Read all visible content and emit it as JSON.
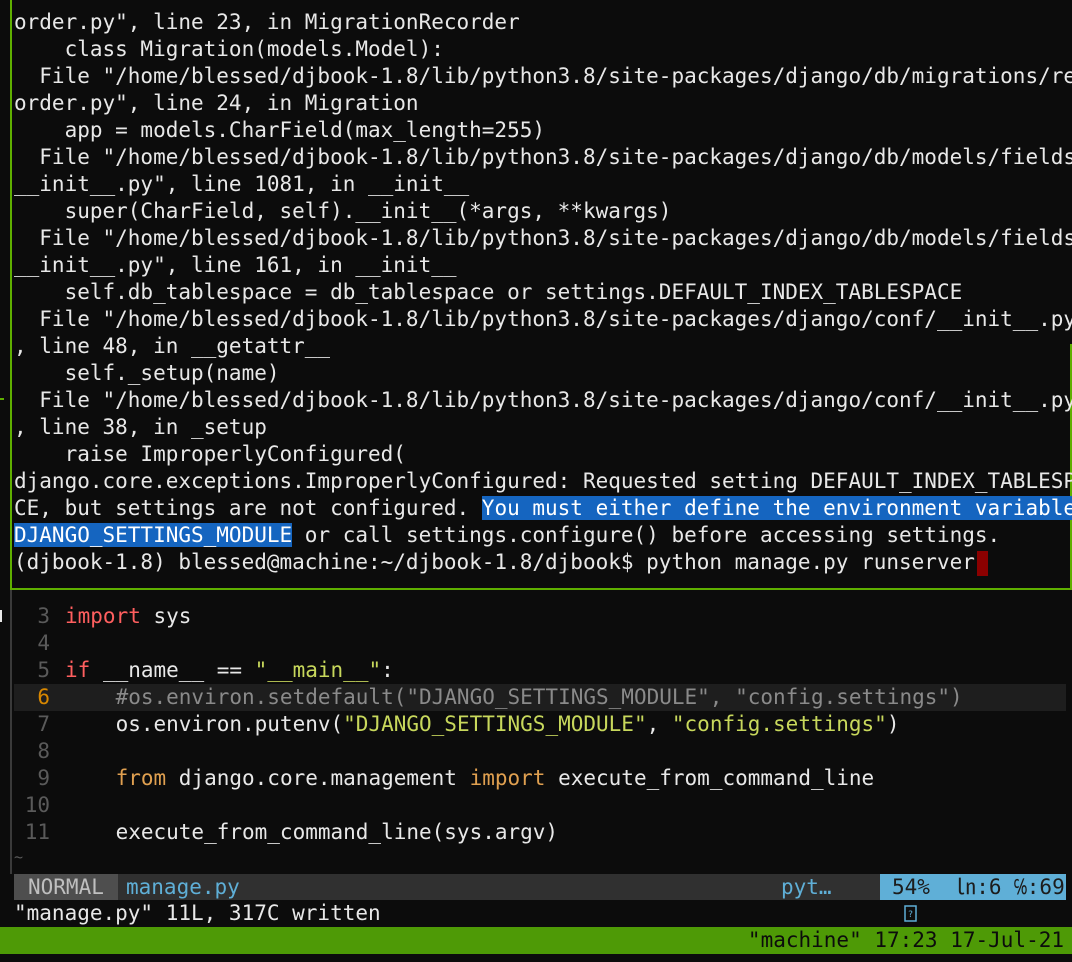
{
  "terminal": {
    "lines": [
      "order.py\", line 23, in MigrationRecorder",
      "    class Migration(models.Model):",
      "  File \"/home/blessed/djbook-1.8/lib/python3.8/site-packages/django/db/migrations/rec",
      "order.py\", line 24, in Migration",
      "    app = models.CharField(max_length=255)",
      "  File \"/home/blessed/djbook-1.8/lib/python3.8/site-packages/django/db/models/fields/",
      "__init__.py\", line 1081, in __init__",
      "    super(CharField, self).__init__(*args, **kwargs)",
      "  File \"/home/blessed/djbook-1.8/lib/python3.8/site-packages/django/db/models/fields/",
      "__init__.py\", line 161, in __init__",
      "    self.db_tablespace = db_tablespace or settings.DEFAULT_INDEX_TABLESPACE",
      "  File \"/home/blessed/djbook-1.8/lib/python3.8/site-packages/django/conf/__init__.py\"",
      ", line 48, in __getattr__",
      "    self._setup(name)",
      "  File \"/home/blessed/djbook-1.8/lib/python3.8/site-packages/django/conf/__init__.py\"",
      ", line 38, in _setup",
      "    raise ImproperlyConfigured(",
      "django.core.exceptions.ImproperlyConfigured: Requested setting DEFAULT_INDEX_TABLESPA"
    ],
    "line19_before": "CE, but settings are not configured. ",
    "line19_selected": "You must either define the environment variable ",
    "line20_selected": "DJANGO_SETTINGS_MODULE",
    "line20_after": " or call settings.configure() before accessing settings.",
    "prompt": "(djbook-1.8) blessed@machine:~/djbook-1.8/djbook$ python manage.py runserver"
  },
  "editor": {
    "line3": {
      "num": "3",
      "t1": "import",
      "t2": " sys"
    },
    "line4": {
      "num": "4"
    },
    "line5": {
      "num": "5",
      "t1": "if",
      "t2": " __name__ == ",
      "t3": "\"__main__\"",
      "t4": ":"
    },
    "line6": {
      "num": "6",
      "text": "    #os.environ.setdefault(\"DJANGO_SETTINGS_MODULE\", \"config.settings\")"
    },
    "line7": {
      "num": "7",
      "t1": "    os.environ.putenv(",
      "t2": "\"DJANGO_SETTINGS_MODULE\"",
      "t3": ", ",
      "t4": "\"config.settings\"",
      "t5": ")"
    },
    "line8": {
      "num": "8"
    },
    "line9": {
      "num": "9",
      "t1": "    ",
      "t2": "from",
      "t3": " django.core.management ",
      "t4": "import",
      "t5": " execute_from_command_line"
    },
    "line10": {
      "num": "10"
    },
    "line11": {
      "num": "11",
      "t1": "    execute_from_command_line(sys.argv)"
    },
    "tilde": "~"
  },
  "statusline": {
    "mode": "NORMAL",
    "filename": "manage.py",
    "filetype": "pyt…",
    "filetype_icon": "unknown-glyph-icon",
    "position": "54%  ㏑:6 ℅:69"
  },
  "message": "\"manage.py\" 11L, 317C written",
  "tmux": {
    "right": "\"machine\" 17:23 17-Jul-21"
  },
  "colors": {
    "border": "#5faf00",
    "selection": "#1565c0",
    "cursor": "#8b0000",
    "tmux_bar": "#4e9a06",
    "status_blue": "#5fafd7"
  }
}
